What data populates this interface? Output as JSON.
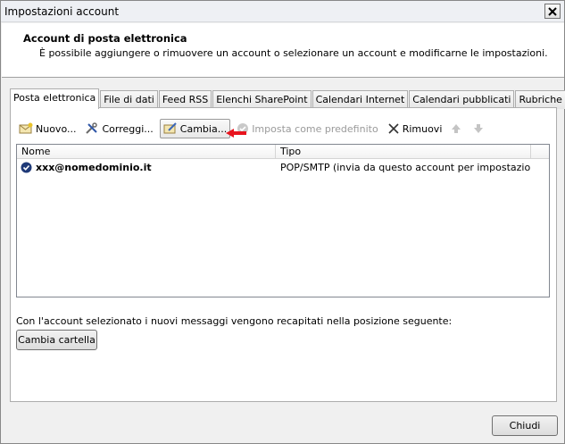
{
  "window": {
    "title": "Impostazioni account"
  },
  "header": {
    "title": "Account di posta elettronica",
    "description": "È possibile aggiungere o rimuovere un account o selezionare un account e modificarne le impostazioni."
  },
  "tabs": [
    {
      "label": "Posta elettronica"
    },
    {
      "label": "File di dati"
    },
    {
      "label": "Feed RSS"
    },
    {
      "label": "Elenchi SharePoint"
    },
    {
      "label": "Calendari Internet"
    },
    {
      "label": "Calendari pubblicati"
    },
    {
      "label": "Rubriche"
    }
  ],
  "toolbar": {
    "new_label": "Nuovo...",
    "repair_label": "Correggi...",
    "change_label": "Cambia...",
    "default_label": "Imposta come predefinito",
    "remove_label": "Rimuovi"
  },
  "list": {
    "columns": {
      "name": "Nome",
      "type": "Tipo"
    },
    "rows": [
      {
        "name": "xxx@nomedominio.it",
        "type": "POP/SMTP (invia da questo account per impostazione p..."
      }
    ]
  },
  "delivery": {
    "text": "Con l'account selezionato i nuovi messaggi vengono recapitati nella posizione seguente:",
    "change_folder_label": "Cambia cartella"
  },
  "footer": {
    "close_label": "Chiudi"
  },
  "colors": {
    "annotation_arrow": "#e8141e",
    "list_border": "#828790"
  }
}
